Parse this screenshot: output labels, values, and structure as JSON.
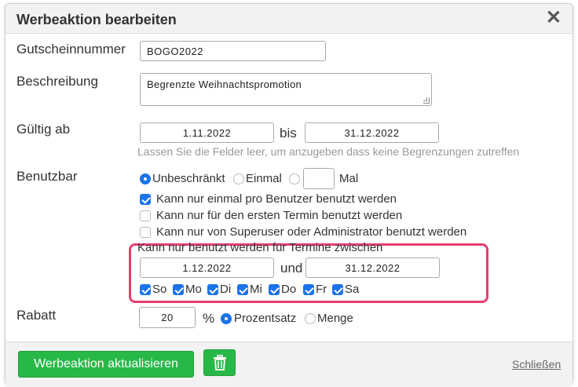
{
  "dialog": {
    "title": "Werbeaktion bearbeiten",
    "close": "✕"
  },
  "fields": {
    "code_label": "Gutscheinnummer",
    "code_value": "BOGO2022",
    "desc_label": "Beschreibung",
    "desc_value": "Begrenzte Weihnachtspromotion",
    "valid_label": "Gültig ab",
    "valid_from": "1.11.2022",
    "valid_bis": "bis",
    "valid_to": "31.12.2022",
    "valid_hint": "Lassen Sie die Felder leer, um anzugeben dass keine Begrenzungen zutreffen",
    "usable_label": "Benutzbar",
    "usage_unlimited": "Unbeschränkt",
    "usage_once": "Einmal",
    "usage_times_value": "",
    "usage_times_suffix": "Mal",
    "cb_once_per_user": "Kann nur einmal pro Benutzer benutzt werden",
    "cb_first_appointment": "Kann nur für den ersten Termin benutzt werden",
    "cb_superuser": "Kann nur von Superuser oder Administrator benutzt werden",
    "between_label": "Kann nur benutzt werden für Termine zwischen",
    "between_from": "1.12.2022",
    "between_und": "und",
    "between_to": "31.12.2022",
    "days": [
      "So",
      "Mo",
      "Di",
      "Mi",
      "Do",
      "Fr",
      "Sa"
    ],
    "discount_label": "Rabatt",
    "discount_value": "20",
    "discount_unit": "%",
    "discount_percent": "Prozentsatz",
    "discount_amount": "Menge"
  },
  "footer": {
    "update_button": "Werbeaktion aktualisieren",
    "close_link": "Schließen"
  },
  "colors": {
    "accent": "#1a73e8",
    "button_green": "#28b848",
    "highlight": "#e83d6f"
  },
  "icons": {
    "delete": "trash-icon",
    "close": "close-icon"
  }
}
